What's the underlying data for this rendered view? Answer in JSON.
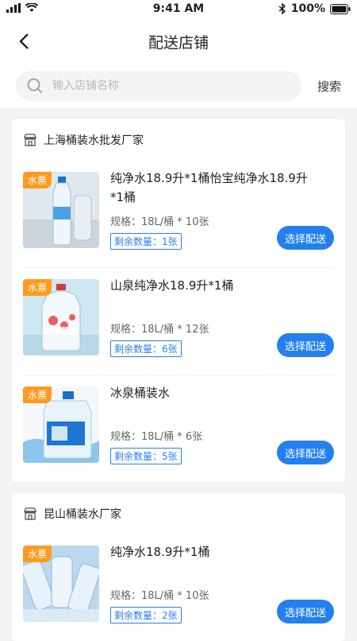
{
  "status_bar": {
    "time": "9:41 AM",
    "battery": "100%"
  },
  "nav": {
    "title": "配送店铺"
  },
  "search": {
    "placeholder": "输入店铺名称",
    "button": "搜索"
  },
  "shops": [
    {
      "name": "上海桶装水批发厂家",
      "products": [
        {
          "tag": "水票",
          "name": "纯净水18.9升*1桶怡宝纯净水18.9升*1桶",
          "spec": "规格：18L/桶 * 10张",
          "remaining": "剩余数量：1张",
          "action": "选择配送"
        },
        {
          "tag": "水票",
          "name": "山泉纯净水18.9升*1桶",
          "spec": "规格：18L/桶 * 12张",
          "remaining": "剩余数量：6张",
          "action": "选择配送"
        },
        {
          "tag": "水票",
          "name": "冰泉桶装水",
          "spec": "规格：18L/桶 * 6张",
          "remaining": "剩余数量：5张",
          "action": "选择配送"
        }
      ]
    },
    {
      "name": "昆山桶装水厂家",
      "products": [
        {
          "tag": "水票",
          "name": "纯净水18.9升*1桶",
          "spec": "规格：18L/桶 * 10张",
          "remaining": "剩余数量：2张",
          "action": "选择配送"
        }
      ]
    }
  ],
  "colors": {
    "accent": "#2380ee",
    "tag": "#ff9a1f",
    "background": "#f2f3f5"
  },
  "icons": [
    "back-arrow-icon",
    "search-icon",
    "store-icon",
    "signal-icon",
    "wifi-icon",
    "bluetooth-icon",
    "battery-icon"
  ]
}
